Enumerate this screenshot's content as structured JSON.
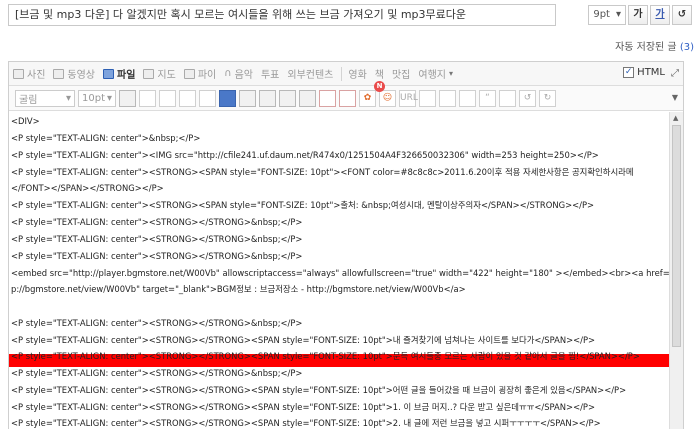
{
  "title": {
    "value": "[브금 및 mp3 다운] 다 알겠지만 혹시 모르는 여시들을 위해 쓰는 브금 가져오기 및 mp3무료다운",
    "font_size": "9pt",
    "bold": "가",
    "underline": "가",
    "undo": "↺"
  },
  "autosave": {
    "label": "자동 저장된 글",
    "count": "(3)"
  },
  "insert_bar": {
    "photo": "사진",
    "video": "동영상",
    "file": "파일",
    "map": "지도",
    "fee": "파이",
    "music": "음악",
    "vote": "투표",
    "external": "외부컨텐츠",
    "movie": "영화",
    "book": "책",
    "restaurant": "맛집",
    "travel": "여행지",
    "html_label": "HTML",
    "html_checked": "✓"
  },
  "format_bar": {
    "font": "굴림",
    "size": "10pt",
    "new_badge": "N",
    "url": "URL"
  },
  "code_lines": [
    "<DIV>",
    "<P style=\"TEXT-ALIGN: center\">&nbsp;</P>",
    "<P style=\"TEXT-ALIGN: center\"><IMG src=\"http://cfile241.uf.daum.net/R474x0/1251504A4F326650032306\" width=253 height=250></P>",
    "<P style=\"TEXT-ALIGN: center\"><STRONG><SPAN style=\"FONT-SIZE: 10pt\"><FONT color=#8c8c8c>2011.6.20이후 적용 자세한사항은 공지확인하시라메",
    "</FONT></SPAN></STRONG></P>",
    "<P style=\"TEXT-ALIGN: center\"><STRONG><SPAN style=\"FONT-SIZE: 10pt\">출처: &nbsp;여성시대, 멘탈이상주의자</SPAN></STRONG></P>",
    "<P style=\"TEXT-ALIGN: center\"><STRONG></STRONG>&nbsp;</P>",
    "<P style=\"TEXT-ALIGN: center\"><STRONG></STRONG>&nbsp;</P>",
    "<P style=\"TEXT-ALIGN: center\"><STRONG></STRONG>&nbsp;</P>",
    "<embed src=\"http://player.bgmstore.net/W00Vb\" allowscriptaccess=\"always\" allowfullscreen=\"true\" width=\"422\" height=\"180\" ></embed><br><a href=\"htt",
    "p://bgmstore.net/view/W00Vb\" target=\"_blank\">BGM정보 : 브금저장소 - http://bgmstore.net/view/W00Vb</a>",
    "<P style=\"TEXT-ALIGN: center\"><STRONG></STRONG>&nbsp;</P>",
    "<P style=\"TEXT-ALIGN: center\"><STRONG></STRONG><SPAN style=\"FONT-SIZE: 10pt\">내 즐겨찾기에 넘쳐나는 사이트를 보다가</SPAN></P>",
    "<P style=\"TEXT-ALIGN: center\"><STRONG></STRONG><SPAN style=\"FONT-SIZE: 10pt\">문득 여시들중 모르는 사람이 있을 것 같아서 글을 찜!</SPAN></P>",
    "<P style=\"TEXT-ALIGN: center\"><STRONG></STRONG>&nbsp;</P>",
    "<P style=\"TEXT-ALIGN: center\"><STRONG></STRONG><SPAN style=\"FONT-SIZE: 10pt\">어떤 글을 들어갔을 때 브금이 굉장히 좋은게 있음</SPAN></P>",
    "<P style=\"TEXT-ALIGN: center\"><STRONG></STRONG><SPAN style=\"FONT-SIZE: 10pt\">1. 이 브금 머지..? 다운 받고 싶은데ㅠㅠ</SPAN></P>",
    "<P style=\"TEXT-ALIGN: center\"><STRONG></STRONG><SPAN style=\"FONT-SIZE: 10pt\">2. 내 글에 저런 브금을 넣고 시퍼ㅜㅜㅜㅜ</SPAN></P>"
  ]
}
